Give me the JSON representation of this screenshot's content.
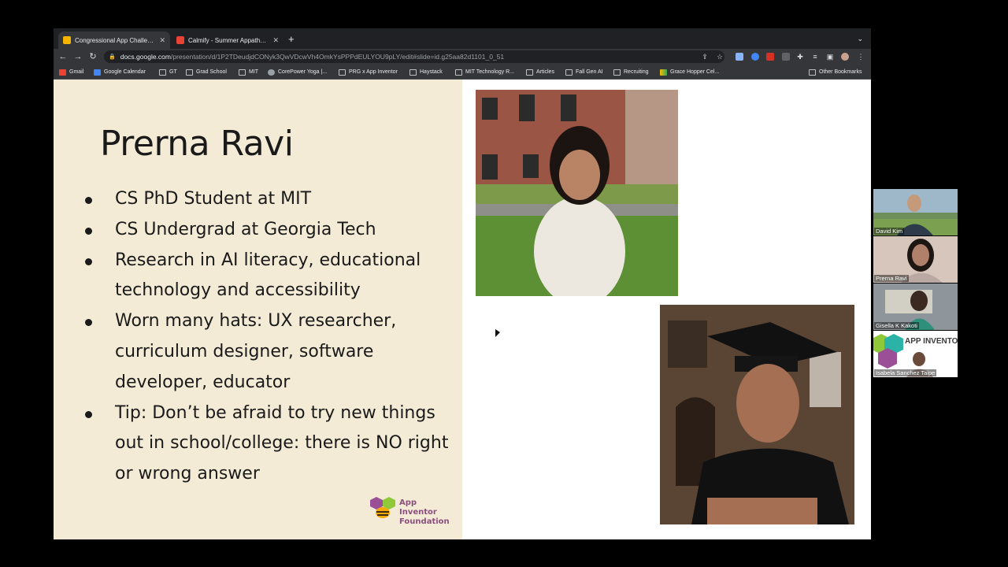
{
  "browser": {
    "tabs": [
      {
        "title": "Congressional App Challenge -",
        "active": true,
        "favicon_color": "#f4b400"
      },
      {
        "title": "Calmify - Summer Appathon 2",
        "active": false,
        "favicon_color": "#ea4335"
      }
    ],
    "new_tab_label": "+",
    "url_host": "docs.google.com",
    "url_path": "/presentation/d/1P2TDeudjdCONyk3QwVDcwVh4OmkYsPPPdEULYOU9pLY/edit#slide=id.g25aa82d1101_0_51",
    "bookmarks": [
      {
        "label": "Gmail",
        "icon": "gmail-icon"
      },
      {
        "label": "Google Calendar",
        "icon": "calendar-icon"
      },
      {
        "label": "GT",
        "icon": "folder-icon"
      },
      {
        "label": "Grad School",
        "icon": "folder-icon"
      },
      {
        "label": "MIT",
        "icon": "folder-icon"
      },
      {
        "label": "CorePower Yoga |...",
        "icon": "globe-icon"
      },
      {
        "label": "PRG x App Inventor",
        "icon": "folder-icon"
      },
      {
        "label": "Haystack",
        "icon": "folder-icon"
      },
      {
        "label": "MIT Technology R...",
        "icon": "folder-icon"
      },
      {
        "label": "Articles",
        "icon": "folder-icon"
      },
      {
        "label": "Fall Gen AI",
        "icon": "folder-icon"
      },
      {
        "label": "Recruiting",
        "icon": "folder-icon"
      },
      {
        "label": "Grace Hopper Cel...",
        "icon": "ghc-icon"
      }
    ],
    "other_bookmarks": "Other Bookmarks"
  },
  "slide": {
    "title": "Prerna Ravi",
    "bullets": [
      "CS PhD Student at MIT",
      "CS Undergrad at Georgia Tech",
      "Research in AI literacy, educational technology and accessibility",
      "Worn many hats: UX researcher, curriculum designer, software developer, educator",
      "Tip: Don’t be afraid to try new things out in school/college: there is NO right or wrong answer"
    ],
    "logo_line1": "App Inventor",
    "logo_line2": "Foundation"
  },
  "participants": [
    {
      "name": "David Kim",
      "bg": "#6f8f5a"
    },
    {
      "name": "Prerna Ravi",
      "bg": "#c9a28f"
    },
    {
      "name": "Gisella K Kakoti",
      "bg": "#7f8a96"
    },
    {
      "name": "Isabela Sanchez Taipe",
      "bg": "#ffffff"
    }
  ]
}
